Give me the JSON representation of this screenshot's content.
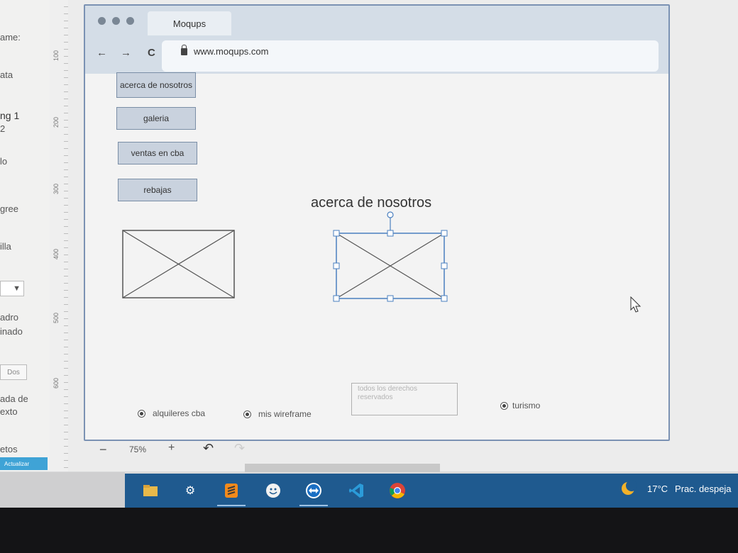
{
  "left_panel": {
    "labels": [
      "ame:",
      "ata",
      "ng 1",
      "2",
      "lo",
      "gree",
      "illa",
      "adro",
      "inado",
      "ada de",
      "exto",
      "etos"
    ],
    "select_value": "▼",
    "box_label": "Dos",
    "button_label": "Actualizar"
  },
  "ruler": {
    "ticks": [
      "100",
      "200",
      "300",
      "400",
      "500",
      "600"
    ]
  },
  "browser": {
    "tab_title": "Moqups",
    "back_icon": "←",
    "forward_icon": "→",
    "reload_icon": "C",
    "url": "www.moqups.com"
  },
  "nav_buttons": [
    {
      "label": "acerca de nosotros"
    },
    {
      "label": "galeria"
    },
    {
      "label": "ventas en cba"
    },
    {
      "label": "rebajas"
    }
  ],
  "heading": "acerca de nosotros",
  "radios": [
    {
      "label": "alquileres cba"
    },
    {
      "label": "mis wireframe"
    },
    {
      "label": "turismo"
    }
  ],
  "textarea_text": "todos los derechos reservados",
  "zoom": {
    "minus": "−",
    "level": "75%",
    "plus": "+",
    "undo_icon": "↶",
    "redo_icon": "↷"
  },
  "taskbar": {
    "weather_temp": "17°C",
    "weather_text": "Prac. despeja",
    "icons": [
      "file-explorer-icon",
      "settings-icon",
      "sublime-text-icon",
      "emoji-icon",
      "teamviewer-icon",
      "vscode-icon",
      "chrome-icon"
    ]
  }
}
